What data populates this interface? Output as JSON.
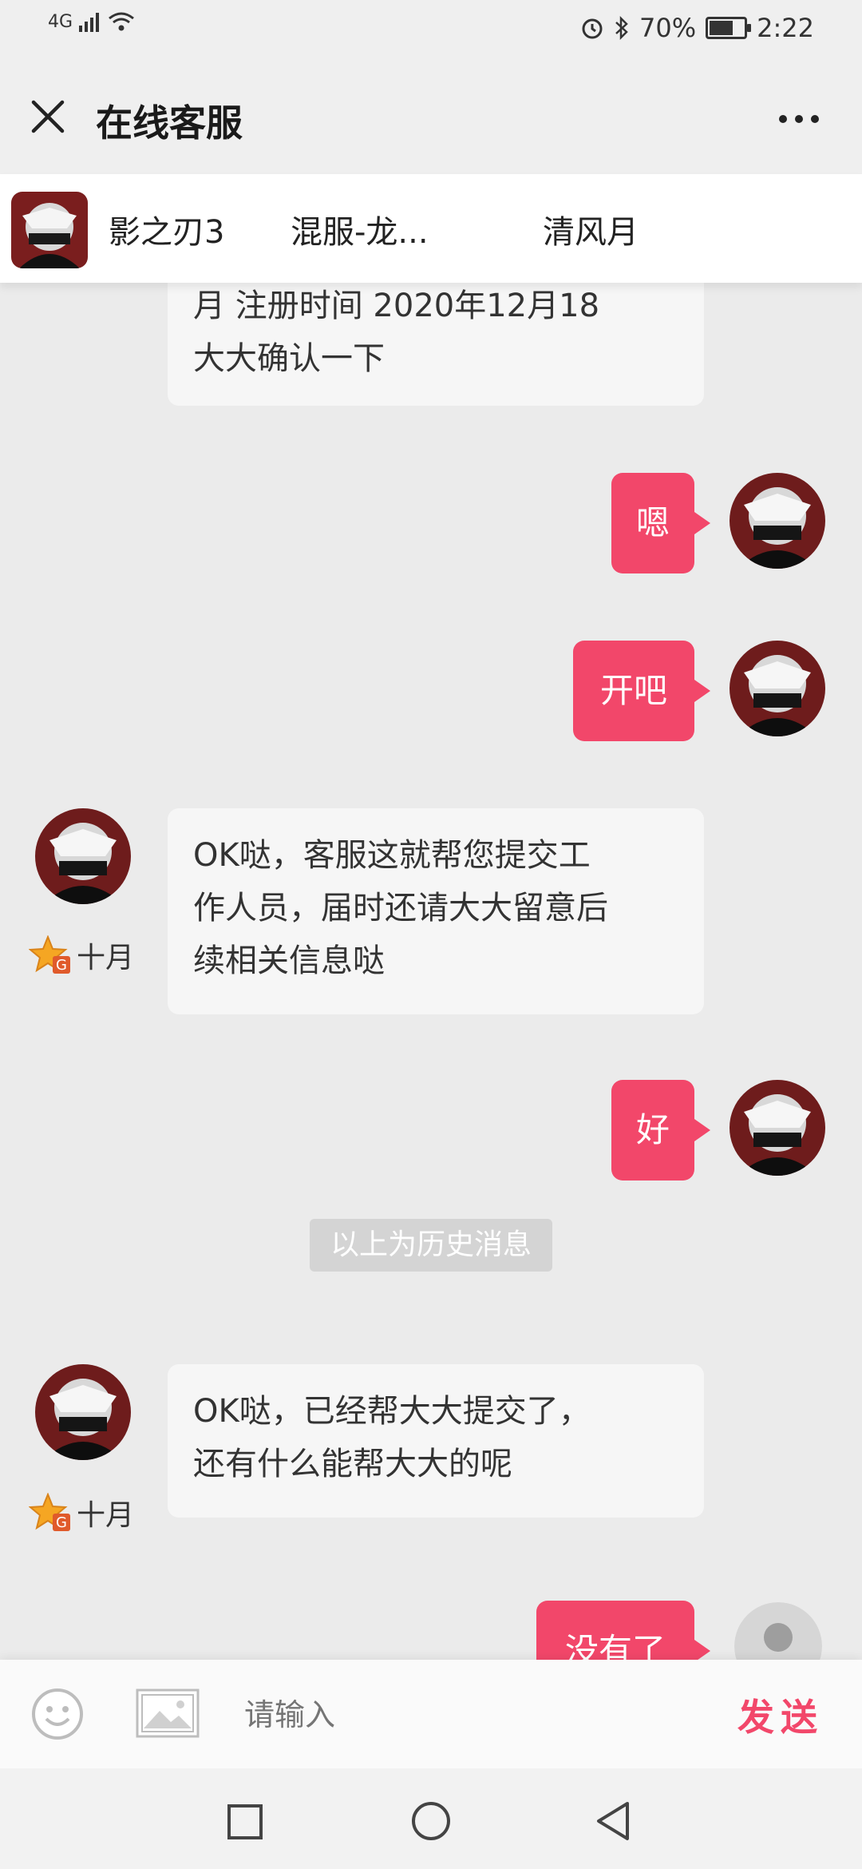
{
  "status": {
    "signal_label": "4G",
    "battery": "70%",
    "time": "2:22",
    "battery_level": 0.7
  },
  "header": {
    "title": "在线客服"
  },
  "game": {
    "name": "影之刃3",
    "server": "混服-龙...",
    "role": "清风月"
  },
  "messages": {
    "m0": {
      "text_line1": "月 注册时间 2020年12月18",
      "text_line2": "大大确认一下"
    },
    "m1": {
      "text": "嗯"
    },
    "m2": {
      "text": "开吧"
    },
    "m3": {
      "agent": "十月",
      "line1": "OK哒，客服这就帮您提交工",
      "line2": "作人员，届时还请大大留意后",
      "line3": "续相关信息哒"
    },
    "m4": {
      "text": "好"
    },
    "history": "以上为历史消息",
    "m5": {
      "agent": "十月",
      "line1": "OK哒，已经帮大大提交了，",
      "line2": "还有什么能帮大大的呢"
    },
    "m6": {
      "text": "没有了"
    }
  },
  "input": {
    "placeholder": "请输入",
    "send_label": "发送"
  },
  "colors": {
    "accent": "#f2476a",
    "background": "#ebebeb"
  },
  "icons": [
    "close-icon",
    "more-icon",
    "emoji-icon",
    "image-icon",
    "back-icon",
    "home-icon",
    "recents-icon"
  ]
}
